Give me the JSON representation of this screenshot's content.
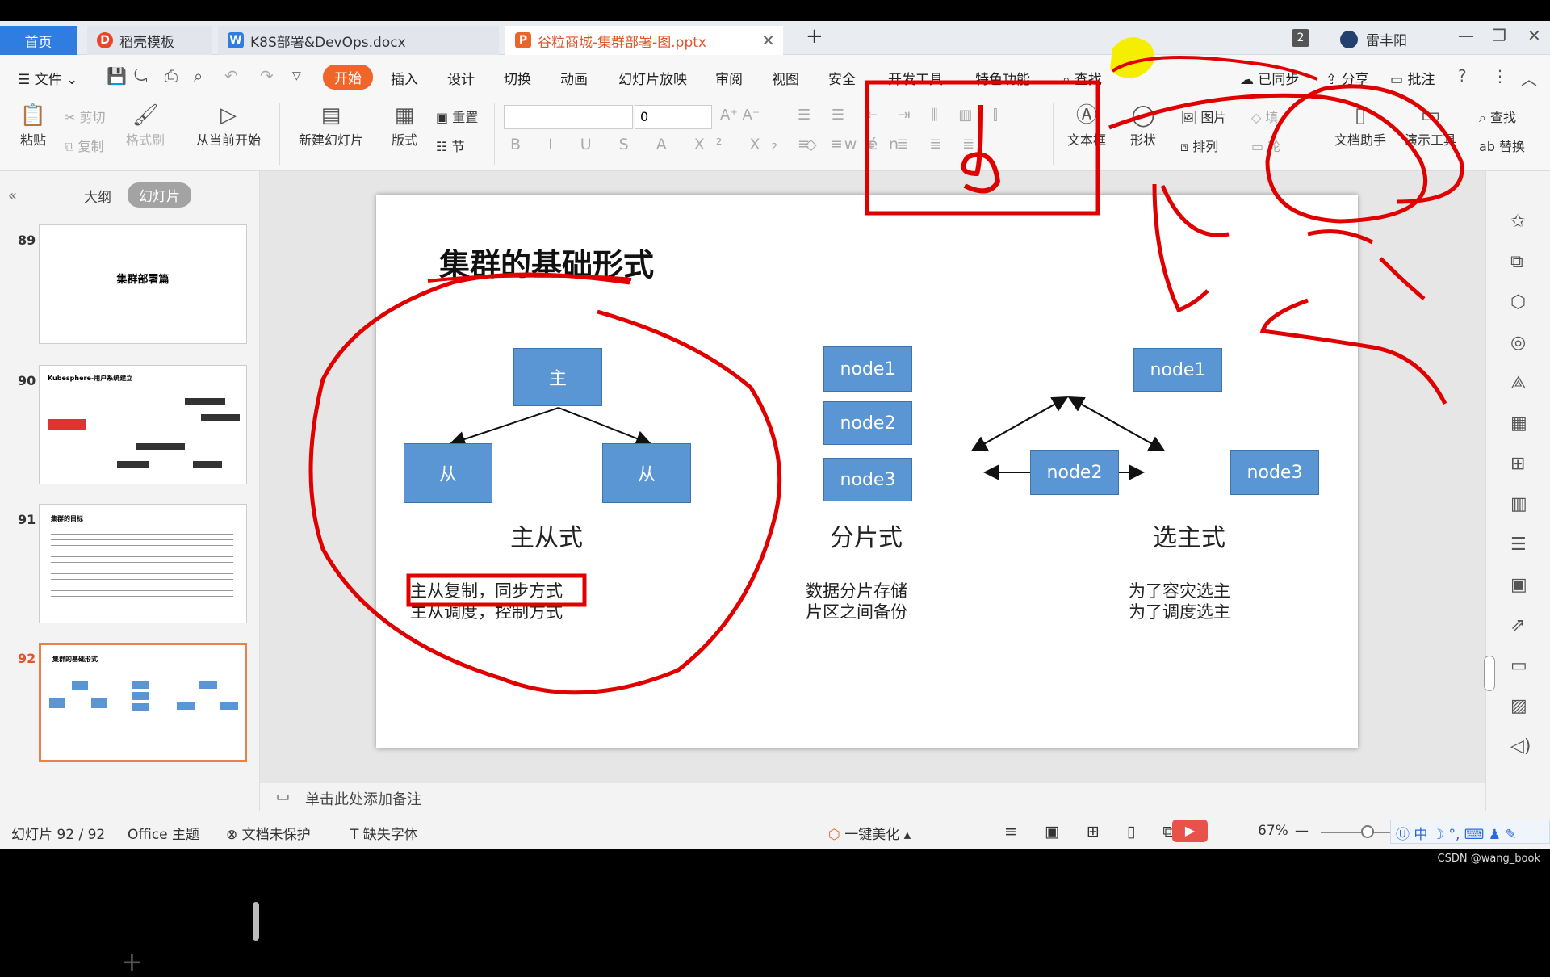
{
  "tabs": {
    "home": "首页",
    "t1": "稻壳模板",
    "t2": "K8S部署&DevOps.docx",
    "t3": "谷粒商城-集群部署-图.pptx",
    "count": "2",
    "user": "雷丰阳"
  },
  "menu": {
    "file": "文件",
    "items": [
      "开始",
      "插入",
      "设计",
      "切换",
      "动画",
      "幻灯片放映",
      "审阅",
      "视图",
      "安全",
      "开发工具",
      "特色功能"
    ],
    "search": "查找",
    "sync": "已同步",
    "share": "分享",
    "comment": "批注"
  },
  "ribbon": {
    "paste": "粘贴",
    "cut": "剪切",
    "copy": "复制",
    "format_painter": "格式刷",
    "from_current": "从当前开始",
    "new_slide": "新建幻灯片",
    "layout": "版式",
    "reset": "重置",
    "section": "节",
    "font_size": "0",
    "textbox": "文本框",
    "shape": "形状",
    "picture": "图片",
    "arrange": "排列",
    "fill": "填",
    "outline": "轮",
    "text_tool": "文档助手",
    "present_tool": "演示工具",
    "find": "查找",
    "replace": "替换"
  },
  "left_panel": {
    "outline": "大纲",
    "slides": "幻灯片",
    "thumbs": [
      {
        "num": "89",
        "title": "集群部署篇"
      },
      {
        "num": "90",
        "title": "Kubesphere-用户系统建立"
      },
      {
        "num": "91",
        "title": "集群的目标"
      },
      {
        "num": "92",
        "title": "集群的基础形式"
      }
    ]
  },
  "slide": {
    "title": "集群的基础形式",
    "master_slave": {
      "master": "主",
      "slave1": "从",
      "slave2": "从",
      "caption": "主从式",
      "desc1": "主从复制，同步方式",
      "desc2": "主从调度，控制方式"
    },
    "sharding": {
      "nodes": [
        "node1",
        "node2",
        "node3"
      ],
      "caption": "分片式",
      "desc1": "数据分片存储",
      "desc2": "片区之间备份"
    },
    "election": {
      "nodes": [
        "node1",
        "node2",
        "node3"
      ],
      "caption": "选主式",
      "desc1": "为了容灾选主",
      "desc2": "为了调度选主"
    }
  },
  "notes": "单击此处添加备注",
  "status": {
    "slide_index": "幻灯片 92 / 92",
    "theme": "Office 主题",
    "protect": "文档未保护",
    "missing_font": "缺失字体",
    "beautify": "一键美化",
    "zoom": "67%",
    "ime": "中"
  },
  "watermark": "CSDN @wang_book",
  "colors": {
    "accent": "#f0652a",
    "node_fill": "#5a96d4",
    "ink": "#e00000",
    "highlighter": "#f5ee00"
  }
}
